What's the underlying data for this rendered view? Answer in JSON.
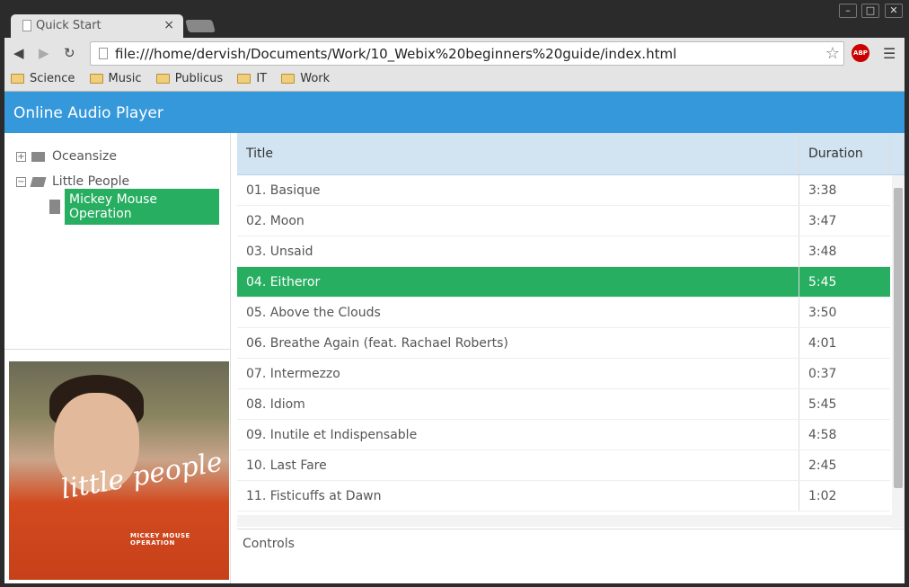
{
  "browser": {
    "tab_title": "Quick Start",
    "url": "file:///home/dervish/Documents/Work/10_Webix%20beginners%20guide/index.html",
    "abp": "ABP",
    "bookmarks": [
      "Science",
      "Music",
      "Publicus",
      "IT",
      "Work"
    ]
  },
  "app": {
    "title": "Online Audio Player",
    "tree": [
      {
        "label": "Oceansize",
        "expanded": false
      },
      {
        "label": "Little People",
        "expanded": true
      },
      {
        "label": "Mickey Mouse Operation",
        "selected": true
      }
    ],
    "album_art": {
      "text1": "little people",
      "text2": "MICKEY MOUSE OPERATION"
    },
    "columns": [
      "Title",
      "Duration"
    ],
    "tracks": [
      [
        "01. Basique",
        "3:38"
      ],
      [
        "02. Moon",
        "3:47"
      ],
      [
        "03. Unsaid",
        "3:48"
      ],
      [
        "04. Eitheror",
        "5:45"
      ],
      [
        "05. Above the Clouds",
        "3:50"
      ],
      [
        "06. Breathe Again (feat. Rachael Roberts)",
        "4:01"
      ],
      [
        "07. Intermezzo",
        "0:37"
      ],
      [
        "08. Idiom",
        "5:45"
      ],
      [
        "09. Inutile et Indispensable",
        "4:58"
      ],
      [
        "10. Last Fare",
        "2:45"
      ],
      [
        "11. Fisticuffs at Dawn",
        "1:02"
      ]
    ],
    "selected_track_index": 3,
    "controls": "Controls",
    "accent": "#3498db",
    "selection": "#27ae60"
  }
}
